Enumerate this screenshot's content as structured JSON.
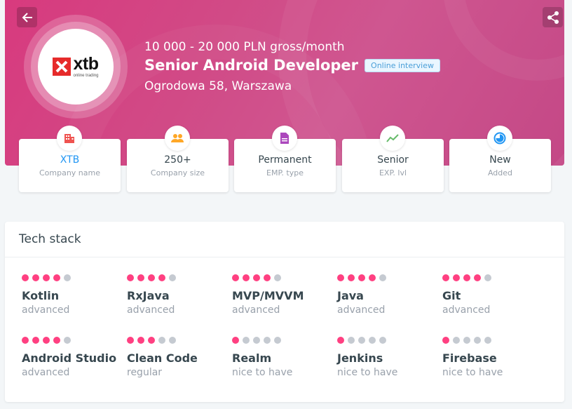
{
  "header": {
    "salary": "10 000 - 20 000 PLN gross/month",
    "title": "Senior Android Developer",
    "badge": "Online interview",
    "address": "Ogrodowa 58, Warszawa",
    "company_logo": {
      "name": "xtb",
      "tagline": "online trading",
      "mark_color": "#e62b2b"
    },
    "back_icon": "arrow-left-icon",
    "share_icon": "share-icon"
  },
  "info_cards": [
    {
      "value": "XTB",
      "label": "Company name",
      "icon": "building-icon",
      "icon_color": "#ef5350"
    },
    {
      "value": "250+",
      "label": "Company size",
      "icon": "people-icon",
      "icon_color": "#ffa726"
    },
    {
      "value": "Permanent",
      "label": "EMP. type",
      "icon": "document-icon",
      "icon_color": "#ab47bc"
    },
    {
      "value": "Senior",
      "label": "EXP. lvl",
      "icon": "trend-icon",
      "icon_color": "#66bb6a"
    },
    {
      "value": "New",
      "label": "Added",
      "icon": "clock-icon",
      "icon_color": "#2196f3"
    }
  ],
  "tech_stack": {
    "title": "Tech stack",
    "skills": [
      {
        "name": "Kotlin",
        "level": "advanced",
        "dots": 4
      },
      {
        "name": "RxJava",
        "level": "advanced",
        "dots": 4
      },
      {
        "name": "MVP/MVVM",
        "level": "advanced",
        "dots": 4
      },
      {
        "name": "Java",
        "level": "advanced",
        "dots": 4
      },
      {
        "name": "Git",
        "level": "advanced",
        "dots": 4
      },
      {
        "name": "Android Studio",
        "level": "advanced",
        "dots": 4
      },
      {
        "name": "Clean Code",
        "level": "regular",
        "dots": 3
      },
      {
        "name": "Realm",
        "level": "nice to have",
        "dots": 1
      },
      {
        "name": "Jenkins",
        "level": "nice to have",
        "dots": 1
      },
      {
        "name": "Firebase",
        "level": "nice to have",
        "dots": 1
      }
    ],
    "max_dots": 5
  },
  "colors": {
    "hero": "#d14a86",
    "accent": "#2196f3",
    "dot_on": "#ff4081",
    "dot_off": "#c5cad1"
  }
}
